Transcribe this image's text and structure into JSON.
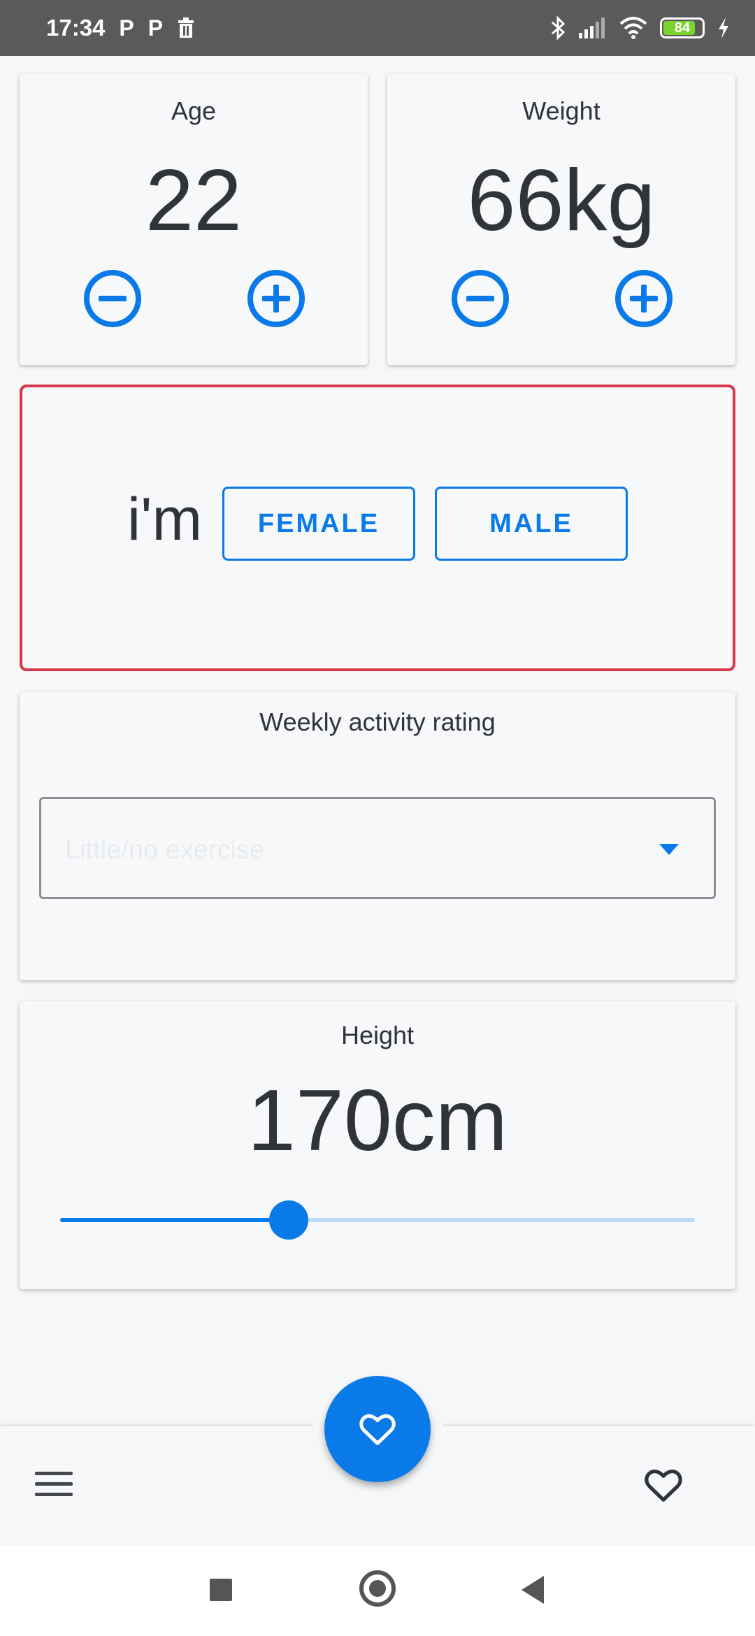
{
  "status_bar": {
    "time": "17:34",
    "left_icons": [
      "P",
      "P"
    ],
    "battery_level": "84",
    "battery_color": "#7bd331"
  },
  "age": {
    "label": "Age",
    "value": "22"
  },
  "weight": {
    "label": "Weight",
    "value": "66kg"
  },
  "gender": {
    "prefix": "i'm",
    "female_label": "FEMALE",
    "male_label": "MALE"
  },
  "activity": {
    "label": "Weekly activity rating",
    "selected": "Little/no exercise"
  },
  "height": {
    "label": "Height",
    "value": "170cm",
    "slider_fraction": 0.36
  },
  "colors": {
    "accent": "#0a7ae8",
    "error_border": "#d4394b"
  },
  "icons": {
    "decrement": "minus-circle-icon",
    "increment": "plus-circle-icon",
    "fab": "heart-icon",
    "menu": "menu-icon",
    "favorites": "heart-outline-icon"
  }
}
